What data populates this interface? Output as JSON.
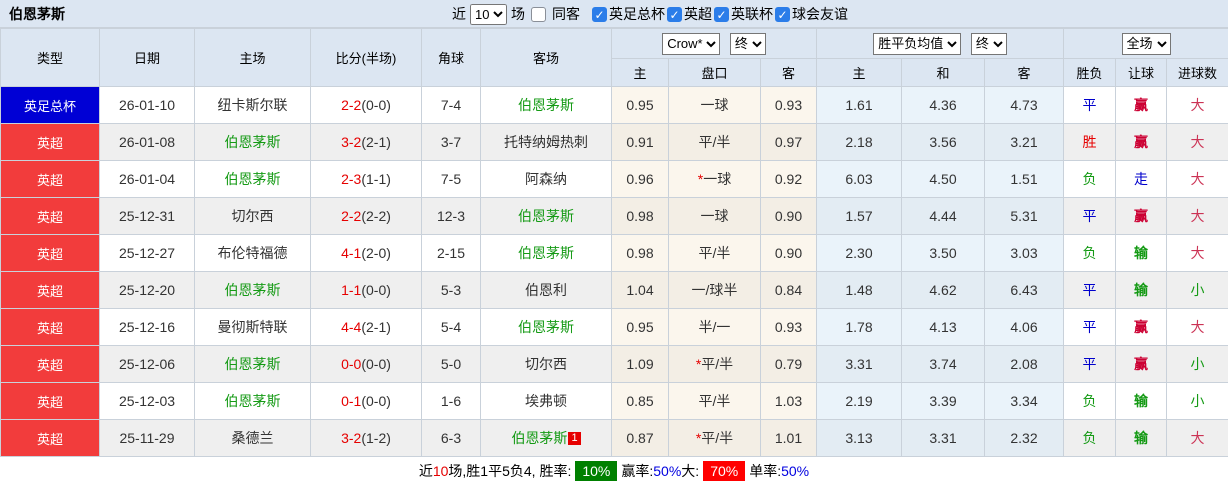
{
  "topbar": {
    "title": "伯恩茅斯",
    "near_label": "近",
    "games_count": "10",
    "games_label": "场",
    "same_opponent_label": "同客",
    "same_opponent_checked": false,
    "league_filters": [
      {
        "label": "英足总杯",
        "checked": true
      },
      {
        "label": "英超",
        "checked": true
      },
      {
        "label": "英联杯",
        "checked": true
      },
      {
        "label": "球会友谊",
        "checked": true
      }
    ]
  },
  "header": {
    "dropdowns": {
      "odds_company": "Crow*",
      "odds_state": "终",
      "avg_type": "胜平负均值",
      "avg_state": "终",
      "scope": "全场"
    }
  },
  "table": {
    "main_columns": [
      "类型",
      "日期",
      "主场",
      "比分(半场)",
      "角球",
      "客场"
    ],
    "sub_columns": [
      "主",
      "盘口",
      "客",
      "主",
      "和",
      "客",
      "胜负",
      "让球",
      "进球数"
    ],
    "rows": [
      {
        "league": {
          "text": "英足总杯",
          "color": "blue"
        },
        "date": "26-01-10",
        "home": {
          "text": "纽卡斯尔联",
          "highlight": false
        },
        "score": {
          "full": "2-2",
          "half": "(0-0)"
        },
        "corners": "7-4",
        "away": {
          "text": "伯恩茅斯",
          "highlight": true,
          "badge": ""
        },
        "handicap": {
          "home": "0.95",
          "star": false,
          "name": "一球",
          "away": "0.93"
        },
        "avg": {
          "home": "1.61",
          "draw": "4.36",
          "away": "4.73"
        },
        "result": {
          "text": "平",
          "color": "blue"
        },
        "handicap_result": {
          "text": "赢",
          "color": "red"
        },
        "goals_result": {
          "text": "大",
          "color": "red"
        }
      },
      {
        "league": {
          "text": "英超",
          "color": "red"
        },
        "date": "26-01-08",
        "home": {
          "text": "伯恩茅斯",
          "highlight": true
        },
        "score": {
          "full": "3-2",
          "half": "(2-1)"
        },
        "corners": "3-7",
        "away": {
          "text": "托特纳姆热刺",
          "highlight": false,
          "badge": ""
        },
        "handicap": {
          "home": "0.91",
          "star": false,
          "name": "平/半",
          "away": "0.97"
        },
        "avg": {
          "home": "2.18",
          "draw": "3.56",
          "away": "3.21"
        },
        "result": {
          "text": "胜",
          "color": "red"
        },
        "handicap_result": {
          "text": "赢",
          "color": "red"
        },
        "goals_result": {
          "text": "大",
          "color": "red"
        }
      },
      {
        "league": {
          "text": "英超",
          "color": "red"
        },
        "date": "26-01-04",
        "home": {
          "text": "伯恩茅斯",
          "highlight": true
        },
        "score": {
          "full": "2-3",
          "half": "(1-1)"
        },
        "corners": "7-5",
        "away": {
          "text": "阿森纳",
          "highlight": false,
          "badge": ""
        },
        "handicap": {
          "home": "0.96",
          "star": true,
          "name": "一球",
          "away": "0.92"
        },
        "avg": {
          "home": "6.03",
          "draw": "4.50",
          "away": "1.51"
        },
        "result": {
          "text": "负",
          "color": "green"
        },
        "handicap_result": {
          "text": "走",
          "color": "blue"
        },
        "goals_result": {
          "text": "大",
          "color": "red"
        }
      },
      {
        "league": {
          "text": "英超",
          "color": "red"
        },
        "date": "25-12-31",
        "home": {
          "text": "切尔西",
          "highlight": false
        },
        "score": {
          "full": "2-2",
          "half": "(2-2)"
        },
        "corners": "12-3",
        "away": {
          "text": "伯恩茅斯",
          "highlight": true,
          "badge": ""
        },
        "handicap": {
          "home": "0.98",
          "star": false,
          "name": "一球",
          "away": "0.90"
        },
        "avg": {
          "home": "1.57",
          "draw": "4.44",
          "away": "5.31"
        },
        "result": {
          "text": "平",
          "color": "blue"
        },
        "handicap_result": {
          "text": "赢",
          "color": "red"
        },
        "goals_result": {
          "text": "大",
          "color": "red"
        }
      },
      {
        "league": {
          "text": "英超",
          "color": "red"
        },
        "date": "25-12-27",
        "home": {
          "text": "布伦特福德",
          "highlight": false
        },
        "score": {
          "full": "4-1",
          "half": "(2-0)"
        },
        "corners": "2-15",
        "away": {
          "text": "伯恩茅斯",
          "highlight": true,
          "badge": ""
        },
        "handicap": {
          "home": "0.98",
          "star": false,
          "name": "平/半",
          "away": "0.90"
        },
        "avg": {
          "home": "2.30",
          "draw": "3.50",
          "away": "3.03"
        },
        "result": {
          "text": "负",
          "color": "green"
        },
        "handicap_result": {
          "text": "输",
          "color": "green"
        },
        "goals_result": {
          "text": "大",
          "color": "red"
        }
      },
      {
        "league": {
          "text": "英超",
          "color": "red"
        },
        "date": "25-12-20",
        "home": {
          "text": "伯恩茅斯",
          "highlight": true
        },
        "score": {
          "full": "1-1",
          "half": "(0-0)"
        },
        "corners": "5-3",
        "away": {
          "text": "伯恩利",
          "highlight": false,
          "badge": ""
        },
        "handicap": {
          "home": "1.04",
          "star": false,
          "name": "一/球半",
          "away": "0.84"
        },
        "avg": {
          "home": "1.48",
          "draw": "4.62",
          "away": "6.43"
        },
        "result": {
          "text": "平",
          "color": "blue"
        },
        "handicap_result": {
          "text": "输",
          "color": "green"
        },
        "goals_result": {
          "text": "小",
          "color": "green"
        }
      },
      {
        "league": {
          "text": "英超",
          "color": "red"
        },
        "date": "25-12-16",
        "home": {
          "text": "曼彻斯特联",
          "highlight": false
        },
        "score": {
          "full": "4-4",
          "half": "(2-1)"
        },
        "corners": "5-4",
        "away": {
          "text": "伯恩茅斯",
          "highlight": true,
          "badge": ""
        },
        "handicap": {
          "home": "0.95",
          "star": false,
          "name": "半/一",
          "away": "0.93"
        },
        "avg": {
          "home": "1.78",
          "draw": "4.13",
          "away": "4.06"
        },
        "result": {
          "text": "平",
          "color": "blue"
        },
        "handicap_result": {
          "text": "赢",
          "color": "red"
        },
        "goals_result": {
          "text": "大",
          "color": "red"
        }
      },
      {
        "league": {
          "text": "英超",
          "color": "red"
        },
        "date": "25-12-06",
        "home": {
          "text": "伯恩茅斯",
          "highlight": true
        },
        "score": {
          "full": "0-0",
          "half": "(0-0)"
        },
        "corners": "5-0",
        "away": {
          "text": "切尔西",
          "highlight": false,
          "badge": ""
        },
        "handicap": {
          "home": "1.09",
          "star": true,
          "name": "平/半",
          "away": "0.79"
        },
        "avg": {
          "home": "3.31",
          "draw": "3.74",
          "away": "2.08"
        },
        "result": {
          "text": "平",
          "color": "blue"
        },
        "handicap_result": {
          "text": "赢",
          "color": "red"
        },
        "goals_result": {
          "text": "小",
          "color": "green"
        }
      },
      {
        "league": {
          "text": "英超",
          "color": "red"
        },
        "date": "25-12-03",
        "home": {
          "text": "伯恩茅斯",
          "highlight": true
        },
        "score": {
          "full": "0-1",
          "half": "(0-0)"
        },
        "corners": "1-6",
        "away": {
          "text": "埃弗顿",
          "highlight": false,
          "badge": ""
        },
        "handicap": {
          "home": "0.85",
          "star": false,
          "name": "平/半",
          "away": "1.03"
        },
        "avg": {
          "home": "2.19",
          "draw": "3.39",
          "away": "3.34"
        },
        "result": {
          "text": "负",
          "color": "green"
        },
        "handicap_result": {
          "text": "输",
          "color": "green"
        },
        "goals_result": {
          "text": "小",
          "color": "green"
        }
      },
      {
        "league": {
          "text": "英超",
          "color": "red"
        },
        "date": "25-11-29",
        "home": {
          "text": "桑德兰",
          "highlight": false
        },
        "score": {
          "full": "3-2",
          "half": "(1-2)"
        },
        "corners": "6-3",
        "away": {
          "text": "伯恩茅斯",
          "highlight": true,
          "badge": "1"
        },
        "handicap": {
          "home": "0.87",
          "star": true,
          "name": "平/半",
          "away": "1.01"
        },
        "avg": {
          "home": "3.13",
          "draw": "3.31",
          "away": "2.32"
        },
        "result": {
          "text": "负",
          "color": "green"
        },
        "handicap_result": {
          "text": "输",
          "color": "green"
        },
        "goals_result": {
          "text": "大",
          "color": "red"
        }
      }
    ]
  },
  "summary": {
    "segments": [
      {
        "text": "近",
        "style": "plain"
      },
      {
        "text": "10",
        "style": "red"
      },
      {
        "text": "场,胜1平5负4, 胜率:",
        "style": "plain"
      },
      {
        "text": "10%",
        "style": "badge-green"
      },
      {
        "text": " 赢率:",
        "style": "plain"
      },
      {
        "text": "50%",
        "style": "blue"
      },
      {
        "text": " 大:",
        "style": "plain"
      },
      {
        "text": "70%",
        "style": "badge-red"
      },
      {
        "text": " 单率:",
        "style": "plain"
      },
      {
        "text": "50%",
        "style": "blue"
      }
    ]
  },
  "colors": {
    "league_red": "#f23c3c",
    "league_blue": "#0000d5",
    "team_green": "#149a14",
    "score_red": "#e60000",
    "text_blue": "#0000cc",
    "win_red": "#cc0033",
    "badge_green": "#008000",
    "badge_red": "#ff0000"
  }
}
